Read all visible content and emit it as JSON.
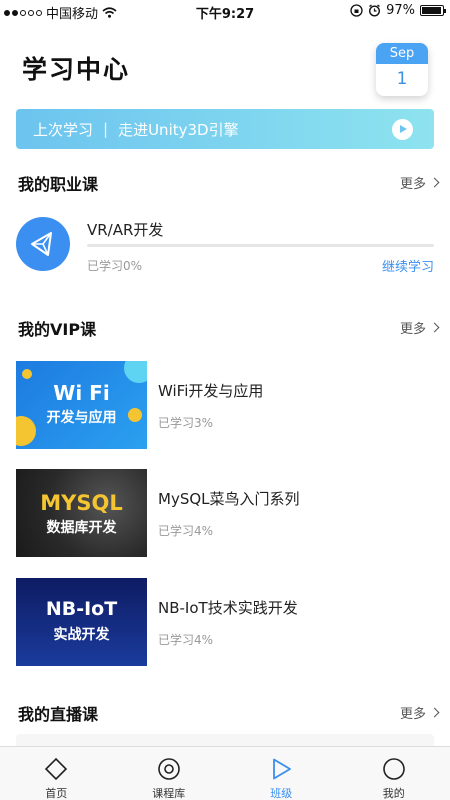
{
  "status_bar": {
    "carrier": "中国移动",
    "time": "下午9:27",
    "battery": "97%",
    "battery_level": 0.97
  },
  "header": {
    "title": "学习中心",
    "calendar_month": "Sep",
    "calendar_day": "1"
  },
  "last_study": {
    "prefix": "上次学习",
    "separator": "|",
    "course": "走进Unity3D引擎"
  },
  "career_section": {
    "title": "我的职业课",
    "more": "更多",
    "course": {
      "name": "VR/AR开发",
      "progress_text": "已学习0%",
      "progress_value": 0,
      "continue": "继续学习"
    }
  },
  "vip_section": {
    "title": "我的VIP课",
    "more": "更多",
    "items": [
      {
        "name": "WiFi开发与应用",
        "progress_text": "已学习3%",
        "thumb_big": "Wi Fi",
        "thumb_small": "开发与应用"
      },
      {
        "name": "MySQL菜鸟入门系列",
        "progress_text": "已学习4%",
        "thumb_big": "MYSQL",
        "thumb_small": "数据库开发"
      },
      {
        "name": "NB-IoT技术实践开发",
        "progress_text": "已学习4%",
        "thumb_big": "NB-IoT",
        "thumb_small": "实战开发"
      }
    ]
  },
  "live_section": {
    "title": "我的直播课",
    "more": "更多"
  },
  "tabbar": {
    "active": "班级",
    "items": [
      {
        "label": "首页",
        "icon": "diamond-icon"
      },
      {
        "label": "课程库",
        "icon": "target-icon"
      },
      {
        "label": "班级",
        "icon": "play-icon"
      },
      {
        "label": "我的",
        "icon": "circle-icon"
      }
    ]
  },
  "colors": {
    "accent": "#3b8ff0",
    "banner_start": "#6cc4ef",
    "banner_end": "#8ee3ef"
  }
}
